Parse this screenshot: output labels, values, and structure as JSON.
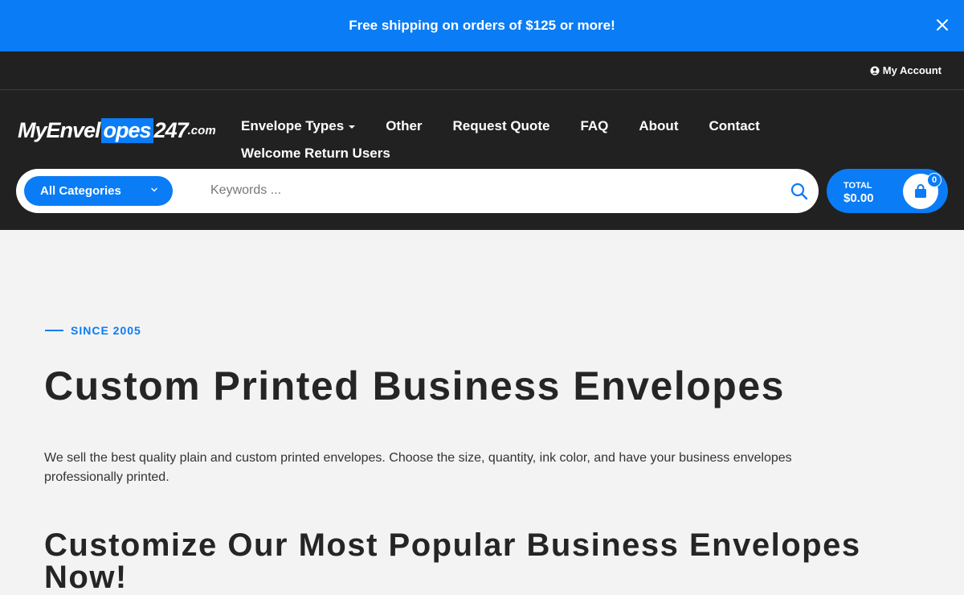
{
  "announcement": {
    "text": "Free shipping on orders of $125 or more!",
    "close_icon": "close-icon"
  },
  "topbar": {
    "account_label": "My Account",
    "account_icon": "user-circle-icon"
  },
  "logo": {
    "part1": "MyEnvel",
    "part2": "opes",
    "part3": "247",
    "part4": ".com"
  },
  "nav": {
    "items": [
      {
        "label": "Envelope Types",
        "has_dropdown": true
      },
      {
        "label": "Other"
      },
      {
        "label": "Request Quote"
      },
      {
        "label": "FAQ"
      },
      {
        "label": "About"
      },
      {
        "label": "Contact"
      },
      {
        "label": "Welcome Return Users"
      }
    ]
  },
  "search": {
    "category": "All Categories",
    "placeholder": "Keywords ...",
    "search_icon": "search-icon"
  },
  "cart": {
    "label": "TOTAL",
    "total": "$0.00",
    "count": "0",
    "icon": "shopping-bag-icon"
  },
  "hero": {
    "eyebrow": "SINCE 2005",
    "title": "Custom Printed Business Envelopes",
    "description": "We sell the best quality plain and custom printed envelopes. Choose the size, quantity, ink color, and have your business envelopes professionally printed.",
    "section_title": "Customize Our Most Popular Business Envelopes Now!"
  },
  "colors": {
    "brand_blue": "#0a7cf5",
    "header_dark": "#212121",
    "page_bg": "#f3f3f3"
  }
}
